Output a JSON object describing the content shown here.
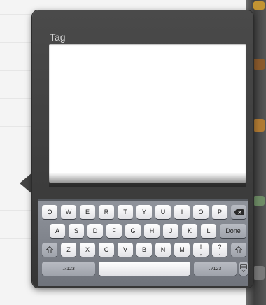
{
  "popover": {
    "title": "Tag",
    "text_value": ""
  },
  "keyboard": {
    "row1": [
      "Q",
      "W",
      "E",
      "R",
      "T",
      "Y",
      "U",
      "I",
      "O",
      "P"
    ],
    "row2": [
      "A",
      "S",
      "D",
      "F",
      "G",
      "H",
      "J",
      "K",
      "L"
    ],
    "row3": [
      "Z",
      "X",
      "C",
      "V",
      "B",
      "N",
      "M"
    ],
    "done_label": "Done",
    "punctuation": [
      {
        "top": "!",
        "bottom": ","
      },
      {
        "top": "?",
        "bottom": "."
      }
    ],
    "numbers_label_left": ".?123",
    "numbers_label_right": ".?123",
    "space_label": "",
    "icons": {
      "backspace": "backspace-icon",
      "shift": "shift-icon",
      "hide_keyboard": "keyboard-hide-icon"
    }
  }
}
